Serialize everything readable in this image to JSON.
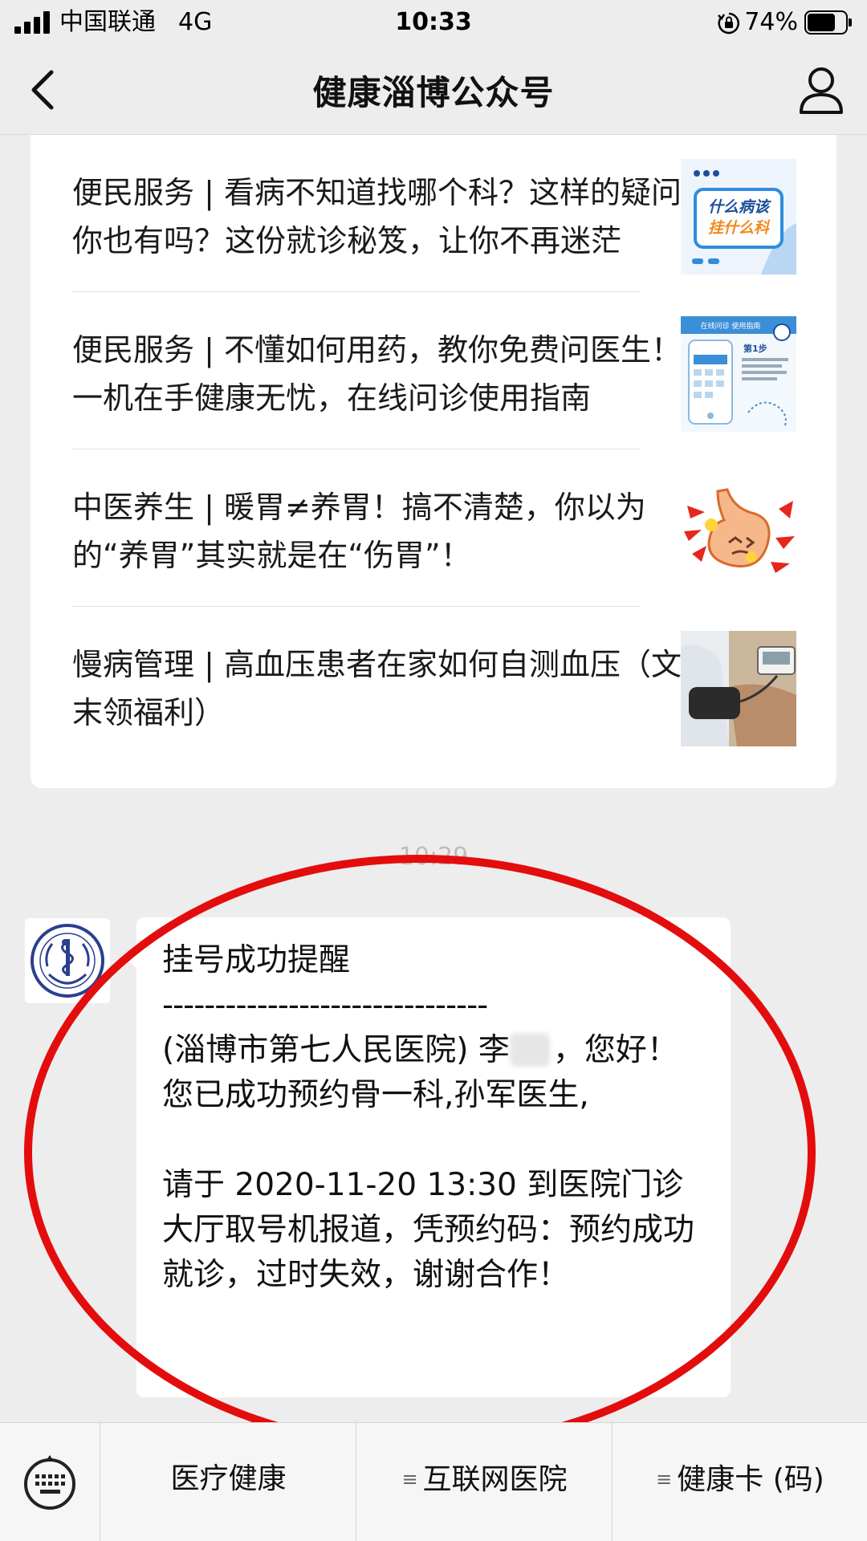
{
  "status_bar": {
    "carrier": "中国联通",
    "network": "4G",
    "time": "10:33",
    "battery_percent": "74%",
    "battery_level": 0.74,
    "icons": [
      "signal-icon",
      "orientation-lock-icon",
      "battery-icon"
    ]
  },
  "nav": {
    "title": "健康淄博公众号",
    "icons": [
      "back-icon",
      "profile-icon"
    ]
  },
  "articles": [
    {
      "text": "便民服务 | 看病不知道找哪个科？这样的疑问你也有吗？这份就诊秘笈，让你不再迷茫",
      "thumbnail_caption": "什么病该挂什么科"
    },
    {
      "text": "便民服务 | 不懂如何用药，教你免费问医生！一机在手健康无忧，在线问诊使用指南",
      "thumbnail_caption": "在线问诊 使用指南",
      "thumbnail_step": "第1步"
    },
    {
      "text": "中医养生 | 暖胃≠养胃！搞不清楚，你以为的“养胃”其实就是在“伤胃”！"
    },
    {
      "text": "慢病管理 | 高血压患者在家如何自测血压（文末领福利）"
    }
  ],
  "chat_time": "10:29",
  "message": {
    "title": "挂号成功提醒",
    "divider": "-------------------------------",
    "line_prefix": "(淄博市第七人民医院) 李",
    "line_rest": "，您好！您已成功预约骨一科,孙军医生,",
    "appointment": "请于 2020-11-20 13:30 到医院门诊大厅取号机报道，凭预约码：预约成功就诊，过时失效，谢谢合作！"
  },
  "bottom_menu": {
    "tabs": [
      {
        "label": "医疗健康",
        "has_submenu": false
      },
      {
        "label": "互联网医院",
        "has_submenu": true
      },
      {
        "label": "健康卡 (码)",
        "has_submenu": true
      }
    ],
    "icons": [
      "keyboard-icon",
      "menu-lines-icon"
    ]
  },
  "colors": {
    "background": "#ededed",
    "card": "#ffffff",
    "annotation_red": "#e30d0d",
    "text": "#111111",
    "muted": "#bdbdbd"
  }
}
